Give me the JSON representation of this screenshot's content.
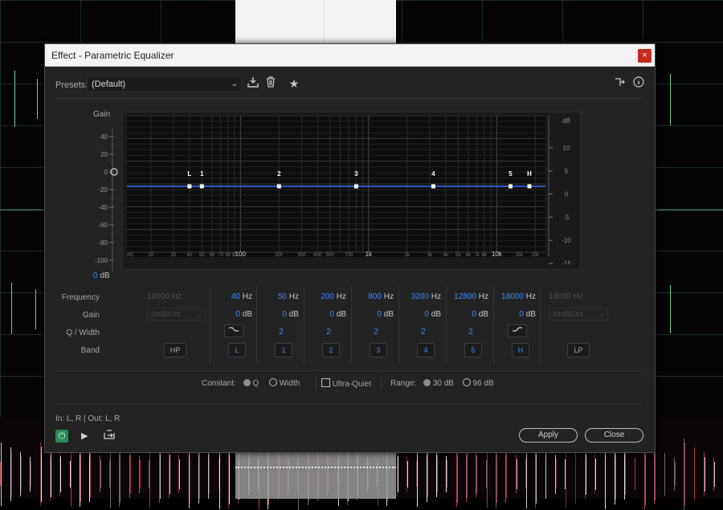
{
  "window": {
    "title": "Effect - Parametric Equalizer",
    "close_glyph": "×"
  },
  "toolbar": {
    "presets_label": "Presets:",
    "preset_value": "(Default)",
    "icons": [
      "download-preset-icon",
      "trash-icon",
      "star-icon",
      "route-icon",
      "info-icon"
    ]
  },
  "graph": {
    "gain_label": "Gain",
    "db_value": "0",
    "db_unit": "dB",
    "left_ticks": [
      "40",
      "20",
      "0",
      "-20",
      "-40",
      "-60",
      "-80",
      "-100"
    ],
    "right_unit": "dB",
    "right_ticks": [
      "10",
      "5",
      "0",
      "-5",
      "-10",
      "-15"
    ],
    "freq_ticks": [
      "Hz",
      "20",
      "30",
      "40",
      "50",
      "60",
      "70",
      "80",
      "90",
      "100",
      "200",
      "300",
      "400",
      "500",
      "700",
      "1k",
      "2k",
      "3k",
      "4k",
      "5k",
      "6k",
      "7k",
      "8k",
      "10k",
      "15k",
      "20k"
    ],
    "curve_color": "#3c6dff",
    "handle_labels": [
      "L",
      "1",
      "2",
      "3",
      "4",
      "5",
      "H"
    ]
  },
  "table": {
    "row_labels": {
      "frequency": "Frequency",
      "gain": "Gain",
      "q_width": "Q / Width",
      "band": "Band"
    },
    "hp": {
      "frequency": "18000",
      "freq_unit": "Hz",
      "slope": "24dB/Oct",
      "label": "HP"
    },
    "lp": {
      "frequency": "18000",
      "freq_unit": "Hz",
      "slope": "24dB/Oct",
      "label": "LP"
    },
    "bands": [
      {
        "label": "L",
        "frequency": "40",
        "gain": "0",
        "q": "",
        "shape": "low-shelf-icon"
      },
      {
        "label": "1",
        "frequency": "50",
        "gain": "0",
        "q": "2"
      },
      {
        "label": "2",
        "frequency": "200",
        "gain": "0",
        "q": "2"
      },
      {
        "label": "3",
        "frequency": "800",
        "gain": "0",
        "q": "2"
      },
      {
        "label": "4",
        "frequency": "3200",
        "gain": "0",
        "q": "2"
      },
      {
        "label": "5",
        "frequency": "12800",
        "gain": "0",
        "q": "2"
      },
      {
        "label": "H",
        "frequency": "18000",
        "gain": "0",
        "q": "",
        "shape": "high-shelf-icon"
      }
    ],
    "freq_unit": "Hz",
    "gain_unit": "dB"
  },
  "options": {
    "constant_label": "Constant:",
    "q_label": "Q",
    "width_label": "Width",
    "ultra_quiet_label": "Ultra-Quiet",
    "range_label": "Range:",
    "range_30": "30 dB",
    "range_96": "96 dB"
  },
  "footer": {
    "io_text": "In: L, R | Out: L, R",
    "apply_label": "Apply",
    "close_label": "Close"
  }
}
